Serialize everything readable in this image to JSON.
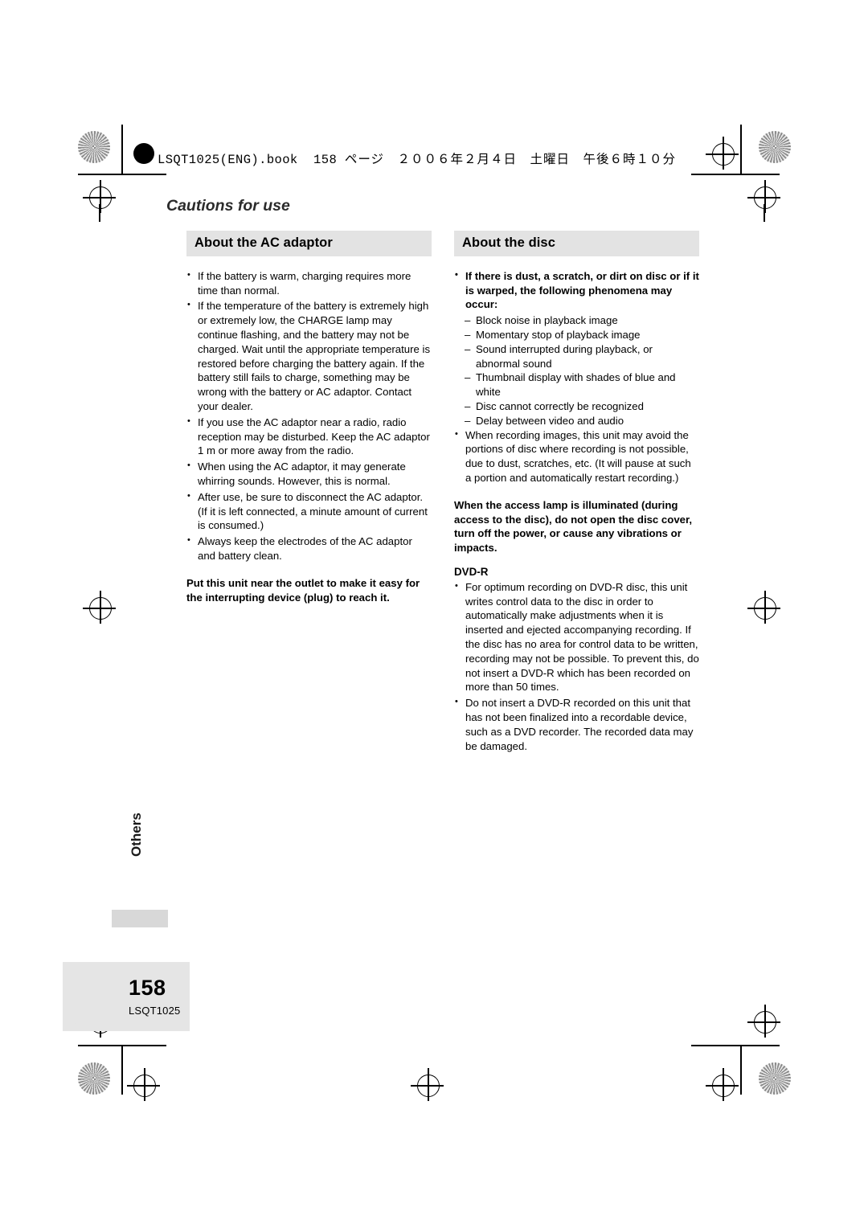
{
  "page": {
    "file_header_book": "LSQT1025(ENG).book",
    "file_header_page": "158",
    "file_header_jp": "ページ　２００６年２月４日　土曜日　午後６時１０分",
    "running_head": "Cautions for use",
    "side_tab": "Others",
    "page_number": "158",
    "page_code": "LSQT1025"
  },
  "left_column": {
    "title": "About the AC adaptor",
    "bullets": [
      "If the battery is warm, charging requires more time than normal.",
      "If the temperature of the battery is extremely high or extremely low, the CHARGE lamp may continue flashing, and the battery may not be charged. Wait until the appropriate temperature is restored before charging the battery again. If the battery still fails to charge, something may be wrong with the battery or AC adaptor. Contact your dealer.",
      "If you use the AC adaptor near a radio, radio reception may be disturbed. Keep the AC adaptor 1 m or more away from the radio.",
      "When using the AC adaptor, it may generate whirring sounds. However, this is normal.",
      "After use, be sure to disconnect the AC adaptor. (If it is left connected, a minute amount of current is consumed.)",
      "Always keep the electrodes of the AC adaptor and battery clean."
    ],
    "note": "Put this unit near the outlet to make it easy for the interrupting device (plug) to reach it."
  },
  "right_column": {
    "title": "About the disc",
    "bullet_bold": "If there is dust, a scratch, or dirt on disc or if it is warped, the following phenomena may occur:",
    "dashes": [
      "Block noise in playback image",
      "Momentary stop of playback image",
      "Sound interrupted during playback, or abnormal sound",
      "Thumbnail display with shades of blue and white",
      "Disc cannot correctly be recognized",
      "Delay between video and audio"
    ],
    "bullet_after": "When recording images, this unit may avoid the portions of disc where recording is not possible, due to dust, scratches, etc. (It will pause at such a portion and automatically restart recording.)",
    "note": "When the access lamp is illuminated (during access to the disc), do not open the disc cover, turn off the power, or cause any vibrations or impacts.",
    "subhead": "DVD-R",
    "dvdr_bullets": [
      "For optimum recording on DVD-R disc, this unit writes control data to the disc in order to automatically make adjustments when it is inserted and ejected accompanying recording. If the disc has no area for control data to be written, recording may not be possible. To prevent this, do not insert a DVD-R which has been recorded on more than 50 times.",
      "Do not insert a DVD-R recorded on this unit that has not been finalized into a recordable device, such as a DVD recorder. The recorded data may be damaged."
    ]
  }
}
